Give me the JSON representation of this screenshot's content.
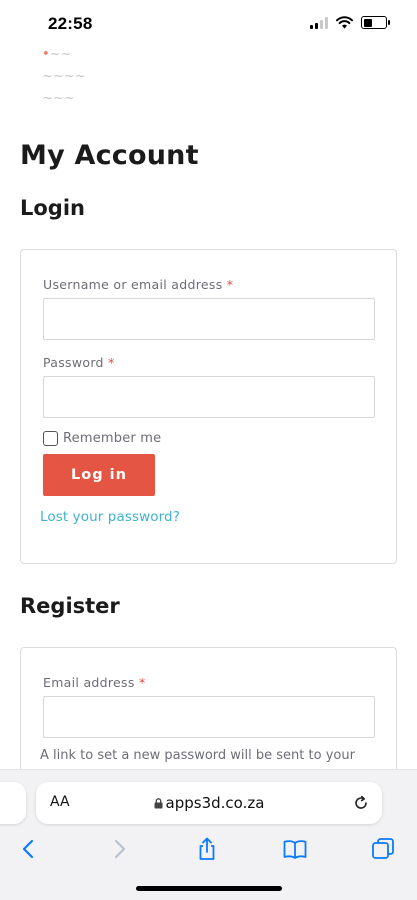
{
  "status_bar": {
    "time": "22:58"
  },
  "page": {
    "title": "My Account",
    "login": {
      "heading": "Login",
      "username_label": "Username or email address",
      "password_label": "Password",
      "required_mark": "*",
      "remember_label": "Remember me",
      "remember_checked": false,
      "submit_label": "Log in",
      "lost_password_label": "Lost your password?"
    },
    "register": {
      "heading": "Register",
      "email_label": "Email address",
      "required_mark": "*",
      "note": "A link to set a new password will be sent to your"
    }
  },
  "browser": {
    "aa_label": "AA",
    "url": "apps3d.co.za"
  },
  "colors": {
    "accent_button": "#e55544",
    "link": "#3fb2cf",
    "required": "#e04b3f",
    "browser_tint": "#0a7aff"
  },
  "icons": [
    "wifi-icon",
    "battery-icon",
    "lock-icon",
    "reload-icon",
    "back-icon",
    "forward-icon",
    "share-icon",
    "bookmarks-icon",
    "tabs-icon"
  ]
}
